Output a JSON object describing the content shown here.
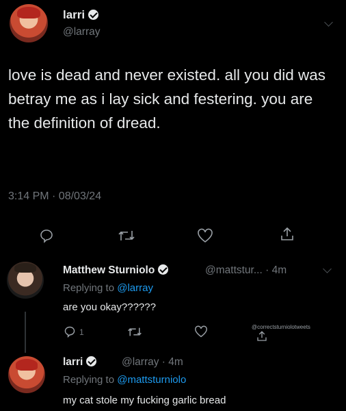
{
  "main_tweet": {
    "name": "larri",
    "handle": "@larray",
    "text": "love is dead and never existed. all you did was betray me as i lay sick and festering. you are the definition of dread.",
    "timestamp": "3:14 PM · 08/03/24"
  },
  "reply1": {
    "name": "Matthew Sturniolo",
    "handle": "@mattstur...",
    "time": "· 4m",
    "replying_prefix": "Replying to ",
    "replying_to": "@larray",
    "text": "are you okay??????",
    "reply_count": "1"
  },
  "watermark": "@correctsturniolotweets",
  "reply2": {
    "name": "larri",
    "handle_time": "@larray · 4m",
    "replying_prefix": "Replying to ",
    "replying_to": "@mattsturniolo",
    "text": "my cat stole my fucking garlic bread"
  },
  "icons": [
    "reply-icon",
    "retweet-icon",
    "like-icon",
    "share-icon",
    "verified-icon",
    "chevron-down-icon"
  ],
  "colors": {
    "background": "#000000",
    "text": "#e7e9ea",
    "muted": "#71767b",
    "link": "#1d9bf0"
  }
}
